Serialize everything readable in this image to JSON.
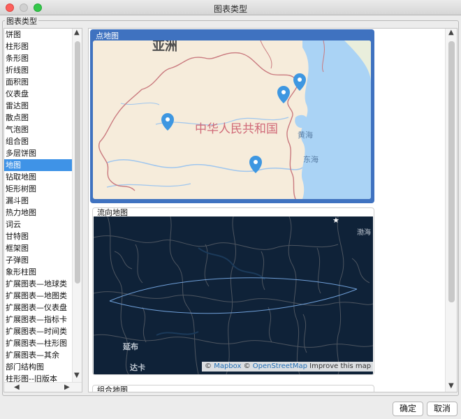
{
  "window": {
    "title": "图表类型"
  },
  "group": {
    "label": "图表类型"
  },
  "chart_types": [
    "饼图",
    "柱形图",
    "条形图",
    "折线图",
    "面积图",
    "仪表盘",
    "雷达图",
    "散点图",
    "气泡图",
    "组合图",
    "多层饼图",
    "地图",
    "钻取地图",
    "矩形树图",
    "漏斗图",
    "热力地图",
    "词云",
    "甘特图",
    "框架图",
    "子弹图",
    "象形柱图",
    "扩展图表—地球类",
    "扩展图表—地图类",
    "扩展图表—仪表盘",
    "扩展图表—指标卡",
    "扩展图表—时间类",
    "扩展图表—柱形图",
    "扩展图表—其余",
    "部门结构图",
    "柱形图--旧版本"
  ],
  "selected_type": "地图",
  "previews": {
    "point_map": {
      "label": "点地图",
      "map_labels": {
        "country": "中华人民共和国",
        "top": "亚洲",
        "yellow_sea": "黄海",
        "east_sea": "东海"
      }
    },
    "flow_map": {
      "label": "流向地图",
      "map_labels": {
        "bohai": "渤海",
        "yanan": "延布",
        "daka": "达卡"
      },
      "attribution": {
        "copyright1": "©",
        "mapbox": "Mapbox",
        "copyright2": "©",
        "osm": "OpenStreetMap",
        "improve": "Improve this map"
      }
    },
    "combo_map": {
      "label": "组合地图"
    }
  },
  "buttons": {
    "ok": "确定",
    "cancel": "取消"
  },
  "icons": {
    "scroll_up": "▲",
    "scroll_down": "▼",
    "scroll_left": "◀",
    "scroll_right": "▶",
    "star": "★"
  },
  "colors": {
    "selection": "#3f93e7",
    "card_selection": "#3f72c0",
    "map_land": "#f6ecdb",
    "map_water": "#aad3f5",
    "flow_bg": "#0f2238",
    "pin": "#3e97e1",
    "border_red": "#c9797e"
  }
}
